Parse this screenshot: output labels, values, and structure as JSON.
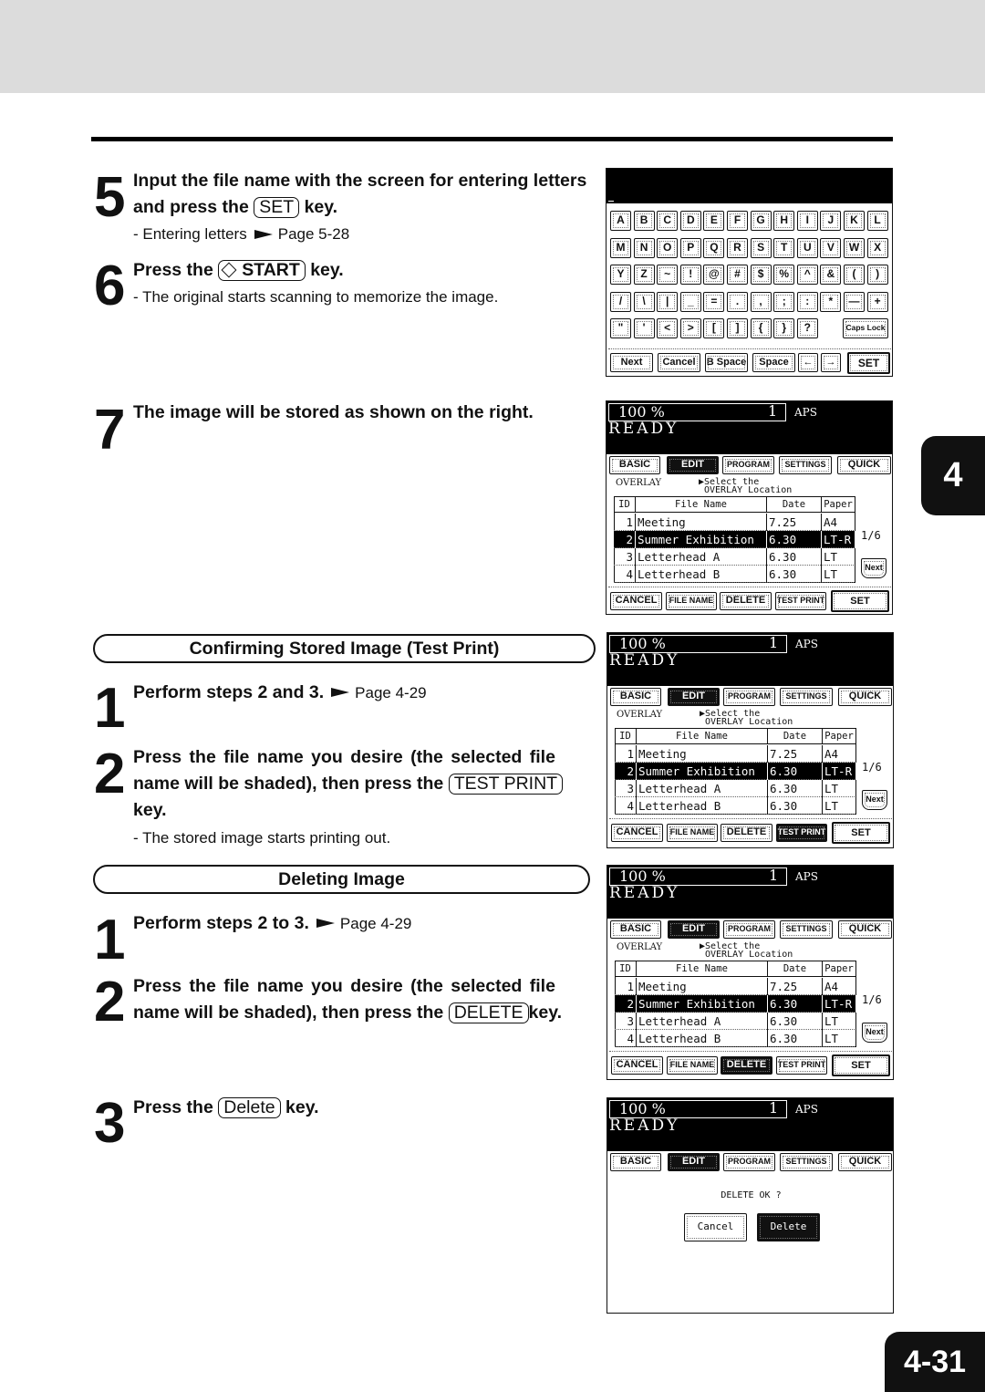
{
  "chapter_tab": "4",
  "page_number": "4-31",
  "steps_main": {
    "s5": {
      "num": "5",
      "line1": "Input the file name with the screen for entering letters",
      "line2_pre": "and press the",
      "key": "SET",
      "line2_post": "key.",
      "sub_text": "- Entering letters",
      "sub_ref": "Page 5-28"
    },
    "s6": {
      "num": "6",
      "pre": "Press the",
      "key": "START",
      "post": "key.",
      "sub": "- The original starts scanning to memorize the image."
    },
    "s7": {
      "num": "7",
      "text": "The image will be stored as shown on the right."
    }
  },
  "section_test": {
    "title": "Confirming Stored Image (Test Print)",
    "s1": {
      "num": "1",
      "text": "Perform steps 2 and 3.",
      "ref": "Page 4-29"
    },
    "s2": {
      "num": "2",
      "line1": "Press the file name you desire (the selected file",
      "line2_pre": "name will be shaded), then press the",
      "key": "TEST PRINT",
      "line3": "key.",
      "sub": "- The stored image starts printing out."
    }
  },
  "section_delete": {
    "title": "Deleting Image",
    "s1": {
      "num": "1",
      "text": "Perform steps 2 to 3.",
      "ref": "Page 4-29"
    },
    "s2": {
      "num": "2",
      "line1": "Press the file name you desire (the selected file",
      "line2_pre": "name will be shaded), then press the",
      "key": "DELETE",
      "line2_post": "key."
    },
    "s3": {
      "num": "3",
      "pre": "Press the",
      "key": "Delete",
      "post": "key."
    }
  },
  "keyboard": {
    "rows": [
      [
        "A",
        "B",
        "C",
        "D",
        "E",
        "F",
        "G",
        "H",
        "I",
        "J",
        "K",
        "L"
      ],
      [
        "M",
        "N",
        "O",
        "P",
        "Q",
        "R",
        "S",
        "T",
        "U",
        "V",
        "W",
        "X"
      ],
      [
        "Y",
        "Z",
        "~",
        "!",
        "@",
        "#",
        "$",
        "%",
        "^",
        "&",
        "(",
        ")"
      ],
      [
        "/",
        "\\",
        "|",
        "_",
        "=",
        ".",
        ",",
        ";",
        ":",
        "*",
        "—",
        "+"
      ],
      [
        "\"",
        "'",
        "<",
        ">",
        "[",
        "]",
        "{",
        "}",
        "?"
      ]
    ],
    "caps_lock": "Caps Lock",
    "bottom": [
      "Next",
      "Cancel",
      "B Space",
      "Space",
      "←",
      "→"
    ],
    "set": "SET"
  },
  "copier": {
    "percent": "100  %",
    "copies": "1",
    "paper_mode": "APS",
    "state": "READY",
    "tabs": [
      "BASIC",
      "EDIT",
      "PROGRAM",
      "SETTINGS",
      "QUICK"
    ],
    "active_tab": 1,
    "overlay_label": "OVERLAY",
    "instruction_1": "▶Select the",
    "instruction_2": "OVERLAY Location",
    "columns": [
      "ID",
      "File Name",
      "Date",
      "Paper"
    ],
    "rows": [
      [
        "1",
        "Meeting",
        "7.25",
        "A4"
      ],
      [
        "2",
        "Summer Exhibition",
        "6.30",
        "LT-R"
      ],
      [
        "3",
        "Letterhead A",
        "6.30",
        "LT"
      ],
      [
        "4",
        "Letterhead B",
        "6.30",
        "LT"
      ]
    ],
    "selected_row": 1,
    "page_indicator": "1/6",
    "next": "Next",
    "buttons": [
      "CANCEL",
      "FILE NAME",
      "DELETE",
      "TEST PRINT",
      "SET"
    ],
    "confirm_text": "DELETE OK ?",
    "confirm_cancel": "Cancel",
    "confirm_delete": "Delete"
  },
  "screens": [
    {
      "highlight": null
    },
    {
      "highlight": 3
    },
    {
      "highlight": 2
    }
  ]
}
